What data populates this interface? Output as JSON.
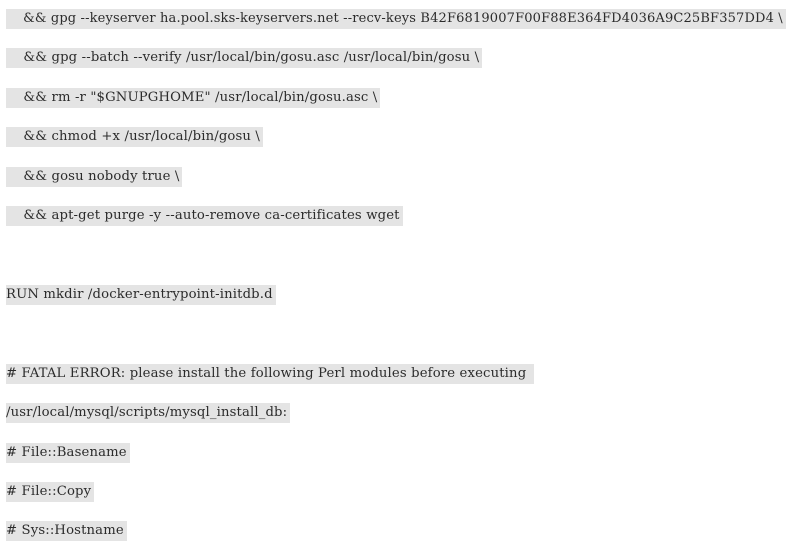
{
  "code_lines": [
    "    && gpg --keyserver ha.pool.sks-keyservers.net --recv-keys B42F6819007F00F88E364FD4036A9C25BF357DD4 \\",
    "    && gpg --batch --verify /usr/local/bin/gosu.asc /usr/local/bin/gosu \\",
    "    && rm -r \"$GNUPGHOME\" /usr/local/bin/gosu.asc \\",
    "    && chmod +x /usr/local/bin/gosu \\",
    "    && gosu nobody true \\",
    "    && apt-get purge -y --auto-remove ca-certificates wget",
    "RUN mkdir /docker-entrypoint-initdb.d",
    "# FATAL ERROR: please install the following Perl modules before executing ",
    "/usr/local/mysql/scripts/mysql_install_db:",
    "# File::Basename",
    "# File::Copy",
    "# Sys::Hostname"
  ]
}
